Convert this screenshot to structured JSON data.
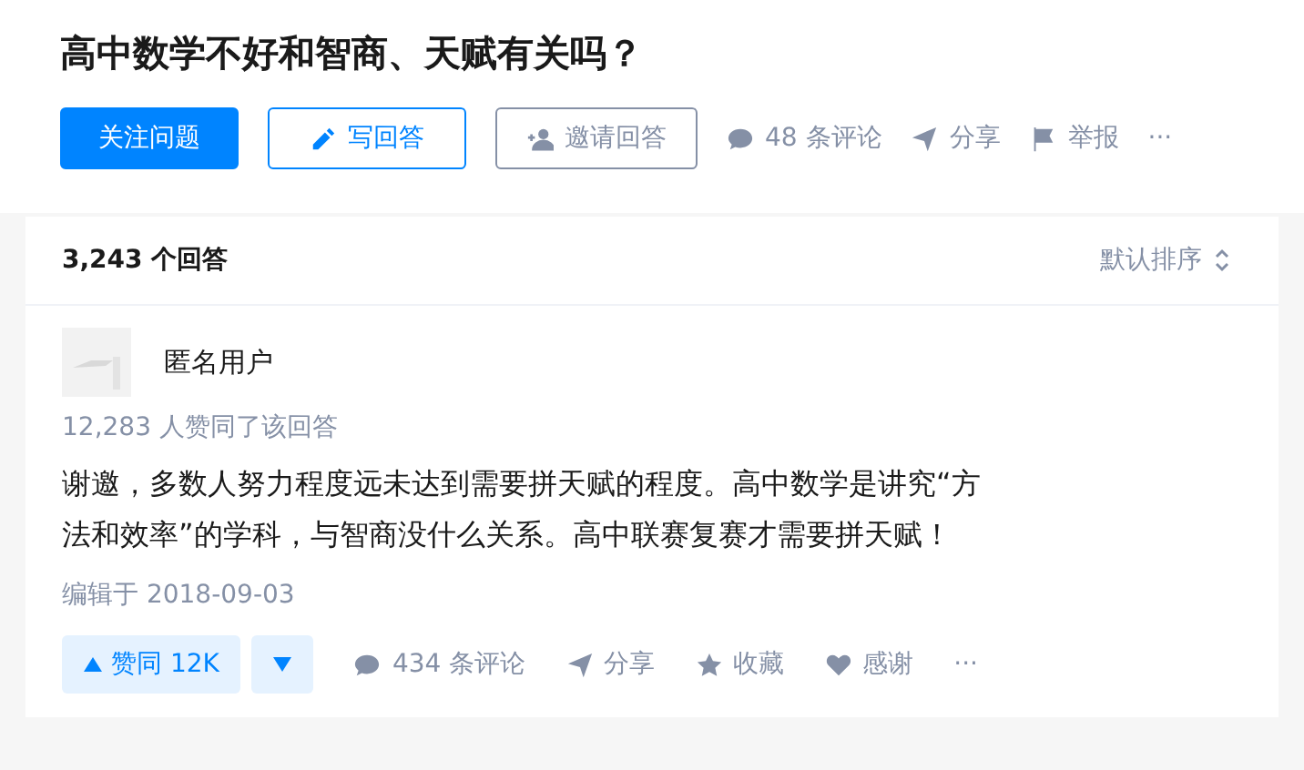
{
  "question": {
    "title": "高中数学不好和智商、天赋有关吗？",
    "actions": [
      {
        "kind": "primary",
        "label": "关注问题"
      },
      {
        "kind": "outline",
        "label": "写回答"
      },
      {
        "kind": "plain",
        "label": "邀请回答"
      },
      {
        "kind": "text",
        "label": "48 条评论"
      },
      {
        "kind": "text",
        "label": "分享"
      },
      {
        "kind": "text",
        "label": "举报"
      },
      {
        "kind": "text",
        "label": "···"
      }
    ]
  },
  "answers_header": {
    "count": "3,243 个回答",
    "sort": "默认排序"
  },
  "answer": {
    "author": "匿名用户",
    "votes_note": "12,283 人赞同了该回答",
    "content": "谢邀，多数人努力程度远未达到需要拼天赋的程度。高中数学是讲究“方法和效率”的学科，与智商没什么关系。高中联赛复赛才需要拼天赋！",
    "edited": "编辑于 2018-09-03",
    "upvote": "赞同 12K",
    "actions": [
      {
        "label": "434 条评论"
      },
      {
        "label": "分享"
      },
      {
        "label": "收藏"
      },
      {
        "label": "感谢"
      },
      {
        "label": "···"
      }
    ]
  }
}
